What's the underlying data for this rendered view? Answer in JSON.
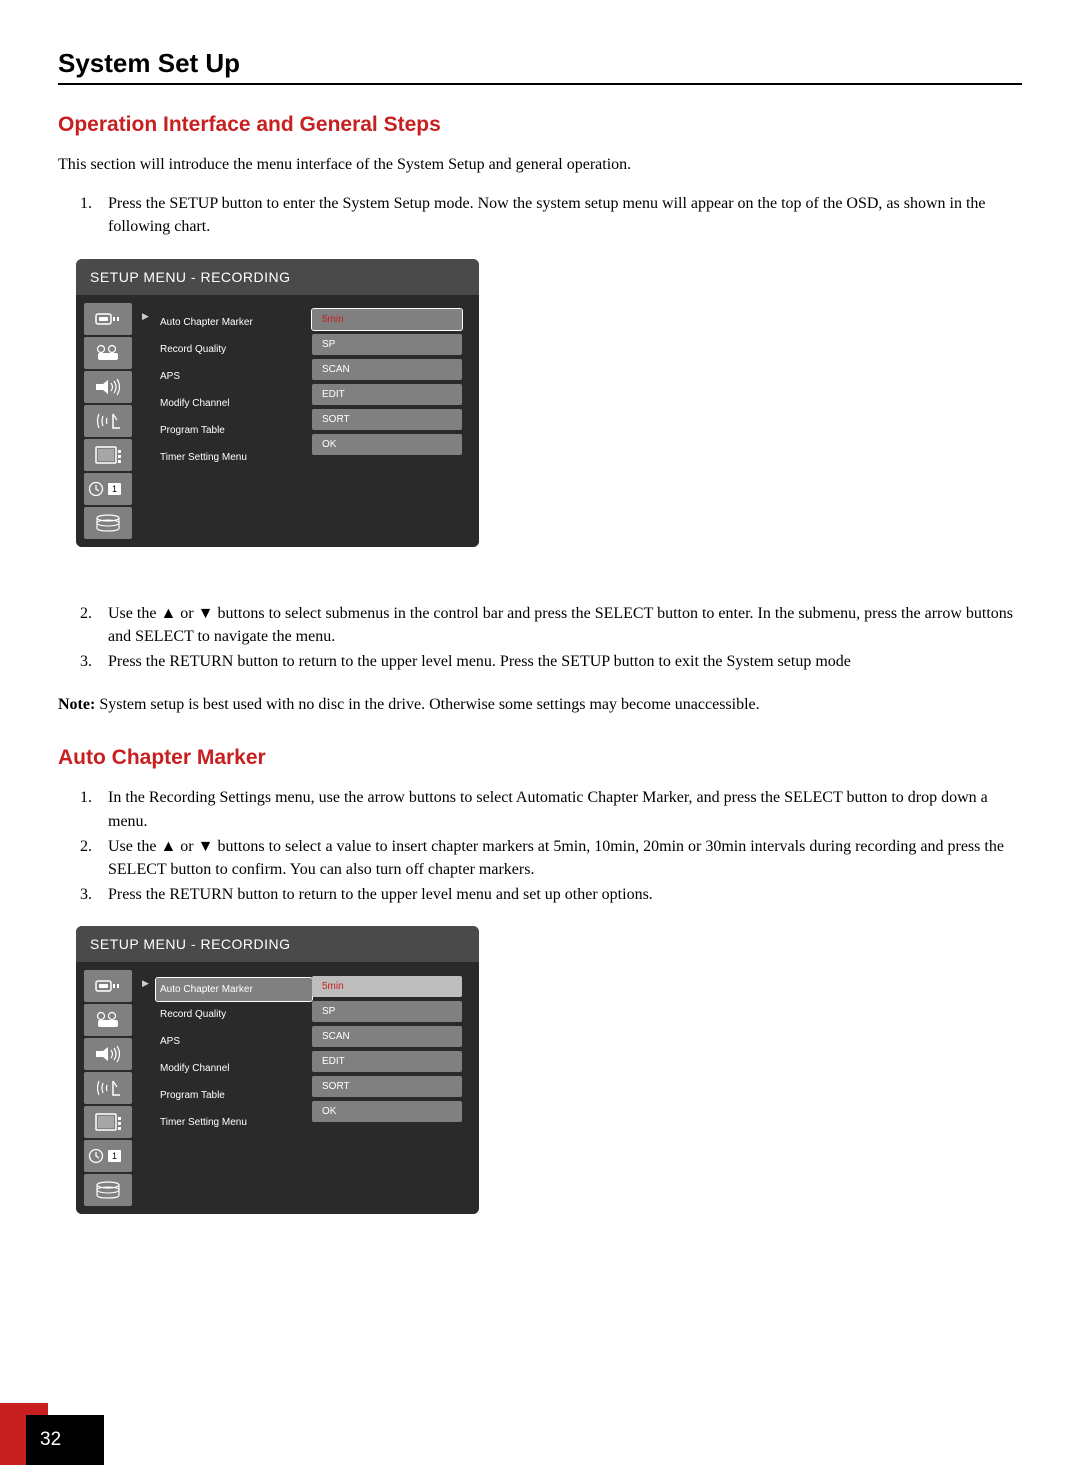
{
  "page": {
    "title": "System Set Up",
    "pageNumber": "32"
  },
  "section1": {
    "title": "Operation Interface and General Steps",
    "intro": "This section will introduce the menu interface of the System Setup and general operation.",
    "step1": "Press the SETUP button to enter the System Setup mode. Now the system setup menu will appear on the top of the OSD, as shown in the following chart.",
    "step2a": "Use the ",
    "step2b": " or ",
    "step2c": " buttons to select submenus in the control bar and press the SELECT button to enter.  In the submenu, press the arrow buttons and SELECT to navigate the menu.",
    "step3": "Press the RETURN button to return to the upper level menu. Press the SETUP button to exit the System setup mode",
    "noteLabel": "Note:",
    "noteText": " System setup is best used with no disc in the drive. Otherwise some settings may become unaccessible."
  },
  "section2": {
    "title": "Auto Chapter Marker",
    "step1": "In the Recording Settings menu, use the arrow buttons to select Automatic Chapter Marker, and press the SELECT button to drop down a menu.",
    "step2a": "Use the ",
    "step2b": " or ",
    "step2c": " buttons to select a value to insert chapter markers at 5min, 10min, 20min or 30min intervals during recording and press the SELECT button to confirm. You can also turn off chapter markers.",
    "step3": "Press the RETURN button to return to the upper level menu and set up other options."
  },
  "osd": {
    "title": "SETUP MENU - RECORDING",
    "labels": [
      "Auto Chapter Marker",
      "Record Quality",
      "APS",
      "Modify Channel",
      "Program Table",
      "Timer Setting Menu"
    ],
    "values": [
      "5min",
      "SP",
      "SCAN",
      "EDIT",
      "SORT",
      "OK"
    ]
  },
  "icons": {
    "arrowUp": "▲",
    "arrowDown": "▼",
    "pointer": "▶",
    "badge": "1"
  }
}
